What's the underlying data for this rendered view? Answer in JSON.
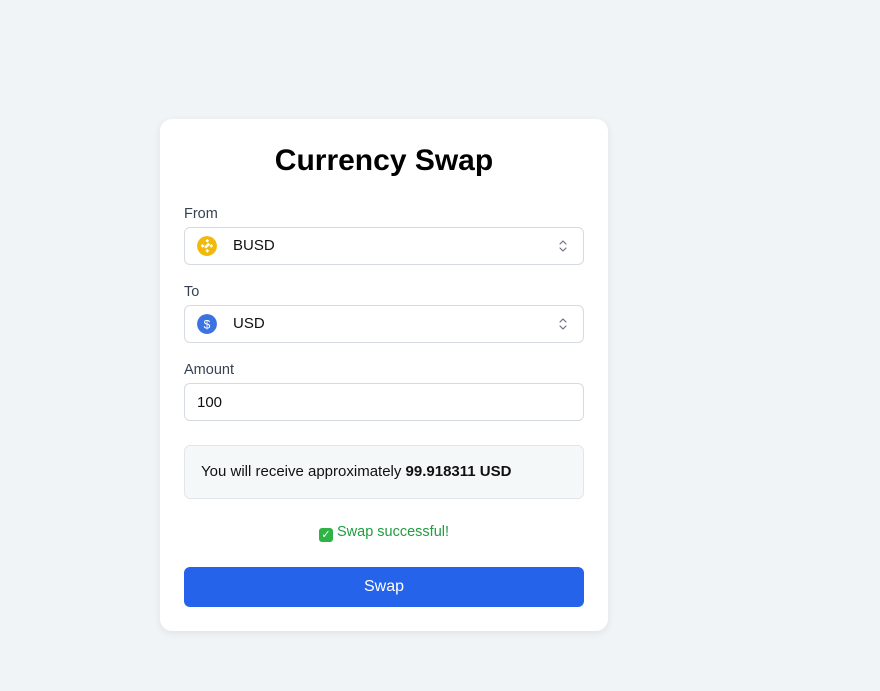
{
  "title": "Currency Swap",
  "from": {
    "label": "From",
    "selected": "BUSD",
    "icon": "busd-coin-icon"
  },
  "to": {
    "label": "To",
    "selected": "USD",
    "icon": "usd-coin-icon"
  },
  "amount": {
    "label": "Amount",
    "value": "100"
  },
  "estimate": {
    "prefix": "You will receive approximately",
    "amount": "99.918311 USD"
  },
  "status": {
    "icon": "check-icon",
    "text": "Swap successful!"
  },
  "swap_button": {
    "label": "Swap"
  },
  "colors": {
    "primary": "#2563eb",
    "success": "#1f9d3f",
    "busd": "#f0b90b",
    "usd": "#3b74e0"
  }
}
